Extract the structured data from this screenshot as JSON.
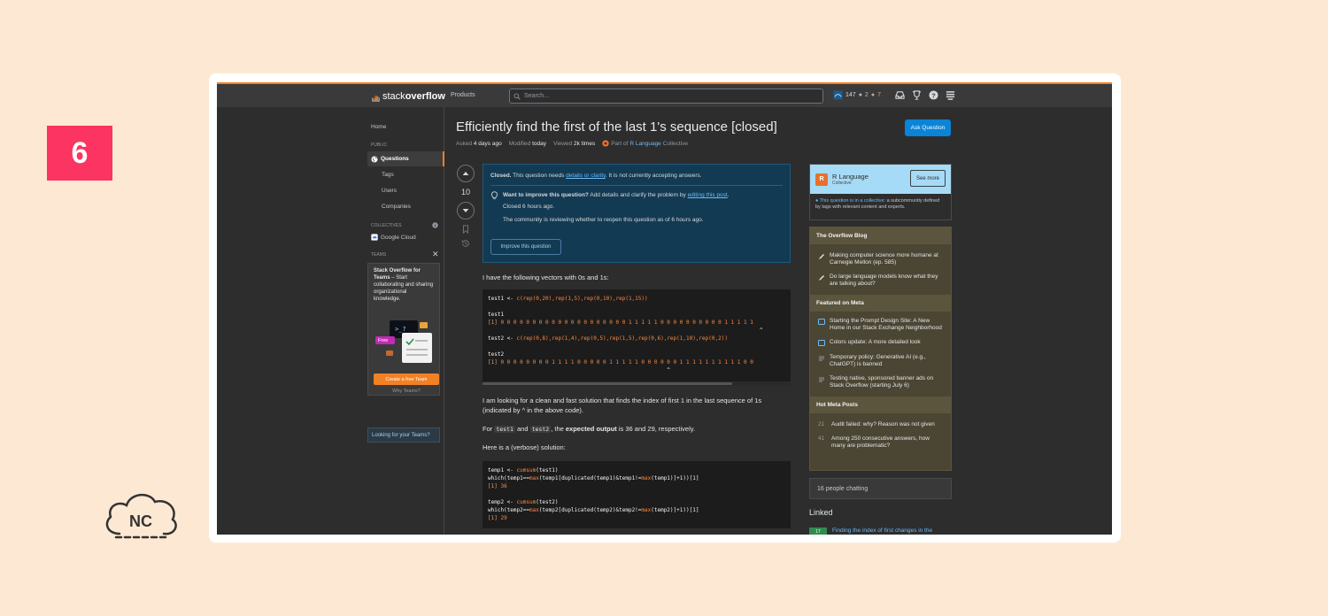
{
  "badge": {
    "number": "6"
  },
  "brand": {
    "logo_text": "NC"
  },
  "topbar": {
    "logo_prefix": "stack",
    "logo_suffix": "overflow",
    "products": "Products",
    "search_placeholder": "Search...",
    "reputation": "147",
    "silver_badges": "2",
    "bronze_badges": "7"
  },
  "leftnav": {
    "home": "Home",
    "public": "PUBLIC",
    "questions": "Questions",
    "tags": "Tags",
    "users": "Users",
    "companies": "Companies",
    "collectives": "COLLECTIVES",
    "google_cloud": "Google Cloud",
    "teams": "TEAMS",
    "teams_title": "Stack Overflow for Teams",
    "teams_desc": " – Start collaborating and sharing organizational knowledge.",
    "free_label": "Free",
    "create_team": "Create a free Team",
    "why_teams": "Why Teams?",
    "looking_for_teams": "Looking for your Teams?"
  },
  "question": {
    "title": "Efficiently find the first of the last 1's sequence [closed]",
    "asked_label": "Asked",
    "asked_value": "4 days ago",
    "modified_label": "Modified",
    "modified_value": "today",
    "viewed_label": "Viewed",
    "viewed_value": "2k times",
    "part_of": "Part of",
    "collective_link": "R Language",
    "collective_suffix": "Collective",
    "ask_button": "Ask Question",
    "votes": "10"
  },
  "closed_notice": {
    "closed_bold": "Closed.",
    "closed_text1": " This question needs ",
    "closed_link": "details or clarity",
    "closed_text2": ". It is not currently accepting answers.",
    "improve_bold": "Want to improve this question?",
    "improve_text": " Add details and clarify the problem by ",
    "improve_link": "editing this post",
    "improve_end": ".",
    "closed_ago": "Closed 6 hours ago.",
    "reviewing": "The community is reviewing whether to reopen this question as of 6 hours ago.",
    "improve_button": "Improve this question"
  },
  "body": {
    "p1": "I have the following vectors with 0s and 1s:",
    "p2": "I am looking for a clean and fast solution that finds the index of first 1 in the last sequence of 1s (indicated by ^ in the above code).",
    "p3_for": "For ",
    "p3_test1": "test1",
    "p3_and": " and ",
    "p3_test2": "test2",
    "p3_mid": ", the ",
    "p3_bold": "expected output",
    "p3_end": " is 36 and 29, respectively.",
    "p4": "Here is a (verbose) solution:"
  },
  "code1": {
    "line1_a": "test1 <- ",
    "line1_b": "c(rep(0,20),rep(1,5),rep(0,10),rep(1,15))",
    "line2": "test1",
    "line3_idx": "[1]",
    "line3_vals": " 0 0 0 0 0 0 0 0 0 0 0 0 0 0 0 0 0 0 0 0 1 1 1 1 1 0 0 0 0 0 0 0 0 0 0 1 1 1 1 1",
    "caret1": "                                                                                     ^",
    "line4_a": "test2 <- ",
    "line4_b": "c(rep(0,8),rep(1,4),rep(0,5),rep(1,5),rep(0,6),rep(1,10),rep(0,2))",
    "line5": "test2",
    "line6_idx": "[1]",
    "line6_vals": " 0 0 0 0 0 0 0 0 1 1 1 1 0 0 0 0 0 1 1 1 1 1 0 0 0 0 0 0 1 1 1 1 1 1 1 1 1 1 0 0",
    "caret2": "                                                        ^"
  },
  "code2": {
    "l1_a": "temp1 <- ",
    "l1_fn": "cumsum",
    "l1_b": "(test1)",
    "l2_a": "which(temp1==",
    "l2_fn": "max",
    "l2_b": "(temp1[duplicated(temp1)&temp1!=",
    "l2_fn2": "max",
    "l2_c": "(temp1)]+1))[1]",
    "l3_idx": "[1]",
    "l3_val": " 36",
    "l4_a": "temp2 <- ",
    "l4_fn": "cumsum",
    "l4_b": "(test2)",
    "l5_a": "which(temp2==",
    "l5_fn": "max",
    "l5_b": "(temp2[duplicated(temp2)&temp2!=",
    "l5_fn2": "max",
    "l5_c": "(temp2)]+1))[1]",
    "l6_idx": "[1]",
    "l6_val": " 29"
  },
  "sidebar": {
    "collective_name": "R Language",
    "collective_sub": "Collective",
    "see_more": "See more",
    "desc_link": "This question is in a collective",
    "desc_text": ": a subcommunity defined by tags with relevant content and experts.",
    "overflow_blog": "The Overflow Blog",
    "blog1": "Making computer science more humane at Carnegie Mellon (ep. 585)",
    "blog2": "Do large language models know what they are talking about?",
    "featured_meta": "Featured on Meta",
    "meta1": "Starting the Prompt Design Site: A New Home in our Stack Exchange Neighborhood",
    "meta2": "Colors update: A more detailed look",
    "meta3": "Temporary policy: Generative AI (e.g., ChatGPT) is banned",
    "meta4": "Testing native, sponsored banner ads on Stack Overflow (starting July 6)",
    "hot_meta": "Hot Meta Posts",
    "hot1_num": "21",
    "hot1": "Audit failed: why? Reason was not given",
    "hot2_num": "41",
    "hot2": "Among 250 consecutive answers, how many are problematic?",
    "chatting": "16 people chatting",
    "linked": "Linked",
    "linked1_num": "17",
    "linked1": "Finding the index of first changes in the"
  },
  "colors": {
    "accent": "#f48024",
    "badge": "#fb3462",
    "link": "#6cbbf7"
  }
}
